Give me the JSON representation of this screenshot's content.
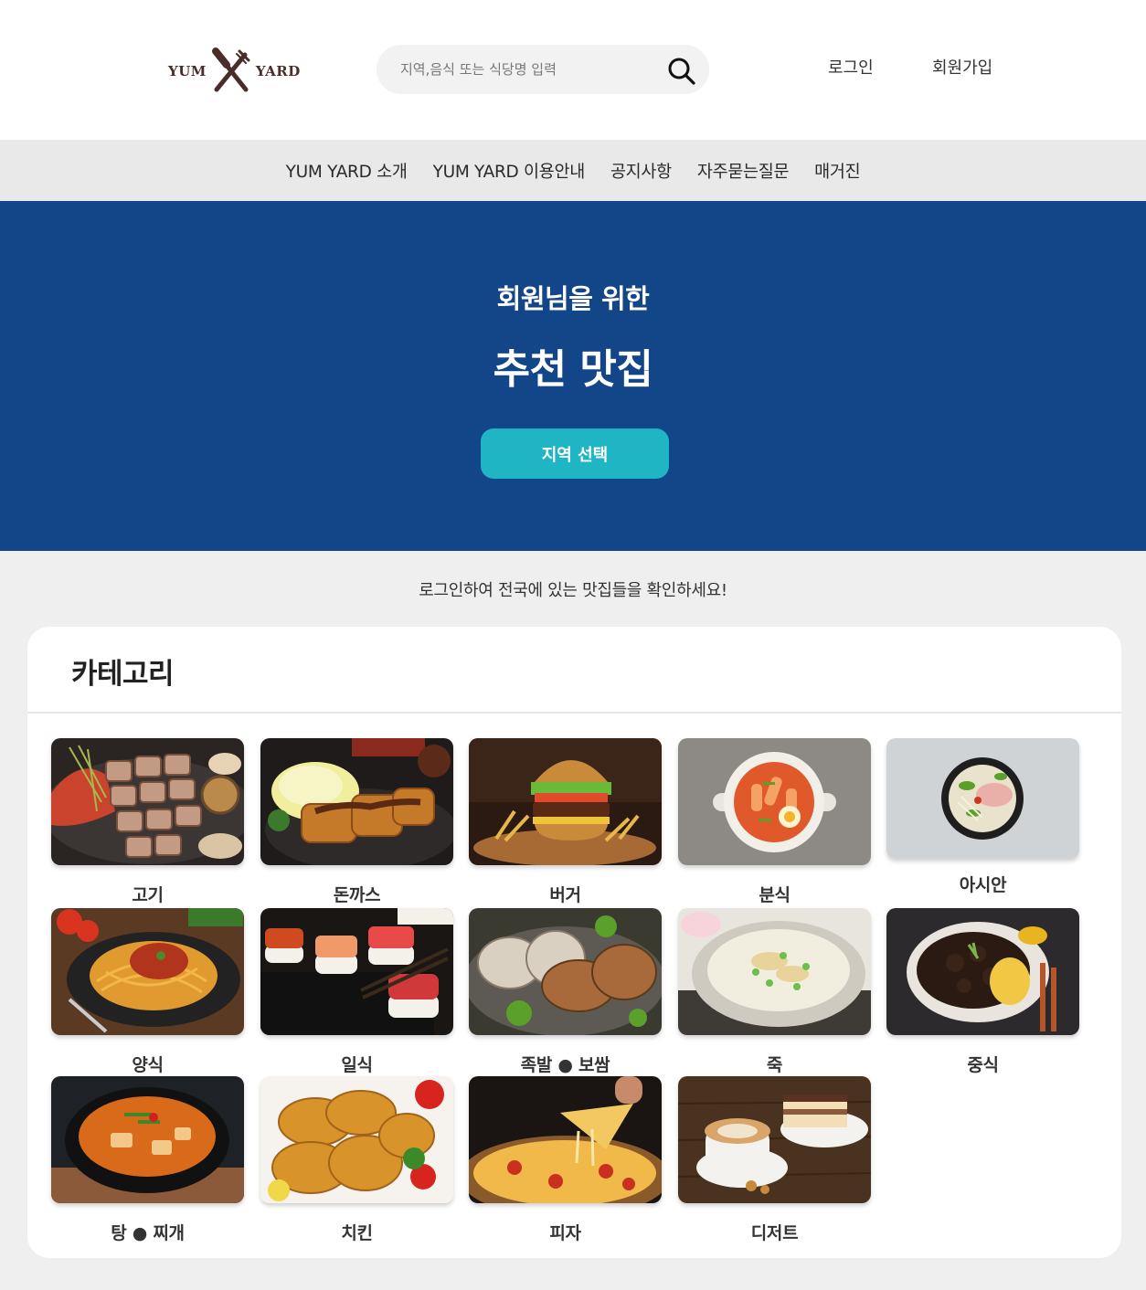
{
  "header": {
    "logo": {
      "left_word": "YUM",
      "right_word": "YARD",
      "icon": "crossed-fork-knife-icon"
    },
    "search": {
      "placeholder": "지역,음식 또는 식당명 입력",
      "value": "",
      "icon": "search-icon"
    },
    "login_label": "로그인",
    "signup_label": "회원가입"
  },
  "nav": {
    "items": [
      {
        "label": "YUM YARD 소개"
      },
      {
        "label": "YUM YARD 이용안내"
      },
      {
        "label": "공지사항"
      },
      {
        "label": "자주묻는질문"
      },
      {
        "label": "매거진"
      }
    ]
  },
  "hero": {
    "subtitle": "회원님을 위한",
    "title": "추천 맛집",
    "button_label": "지역 선택"
  },
  "notice": "로그인하여 전국에 있는 맛집들을 확인하세요!",
  "categories": {
    "title": "카테고리",
    "items": [
      {
        "label": "고기"
      },
      {
        "label": "돈까스"
      },
      {
        "label": "버거"
      },
      {
        "label": "분식"
      },
      {
        "label": "아시안"
      },
      {
        "label": "양식"
      },
      {
        "label": "일식"
      },
      {
        "label": "족발 ● 보쌈"
      },
      {
        "label": "죽"
      },
      {
        "label": "중식"
      },
      {
        "label": "탕 ● 찌개"
      },
      {
        "label": "치킨"
      },
      {
        "label": "피자"
      },
      {
        "label": "디저트"
      }
    ]
  },
  "colors": {
    "hero_bg": "#134688",
    "accent_button": "#1fb5c4",
    "logo_brown": "#4a2c2a",
    "page_bg": "#efefef",
    "nav_bg": "#e9e9e9"
  }
}
